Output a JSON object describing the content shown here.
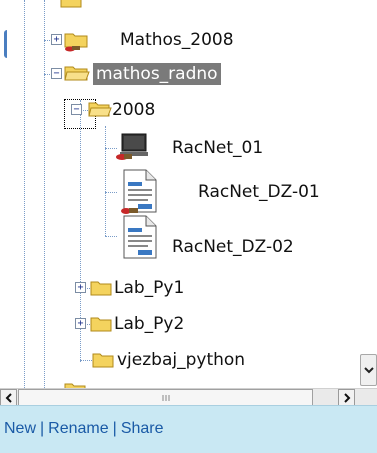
{
  "tree": {
    "nodes": {
      "mathos_2008": "Mathos_2008",
      "mathos_radno": "mathos_radno",
      "folder_2008": "2008",
      "racnet_01": "RacNet_01",
      "racnet_dz_01": "RacNet_DZ-01",
      "racnet_dz_02": "RacNet_DZ-02",
      "lab_py1": "Lab_Py1",
      "lab_py2": "Lab_Py2",
      "vjezbaj_python": "vjezbaj_python"
    }
  },
  "footer": {
    "new": "New",
    "rename": "Rename",
    "share": "Share"
  },
  "colors": {
    "footer_bg": "#c9e8f3",
    "link": "#1a5aa6",
    "selection": "#7a7a7a",
    "folder": "#f4d35e"
  }
}
